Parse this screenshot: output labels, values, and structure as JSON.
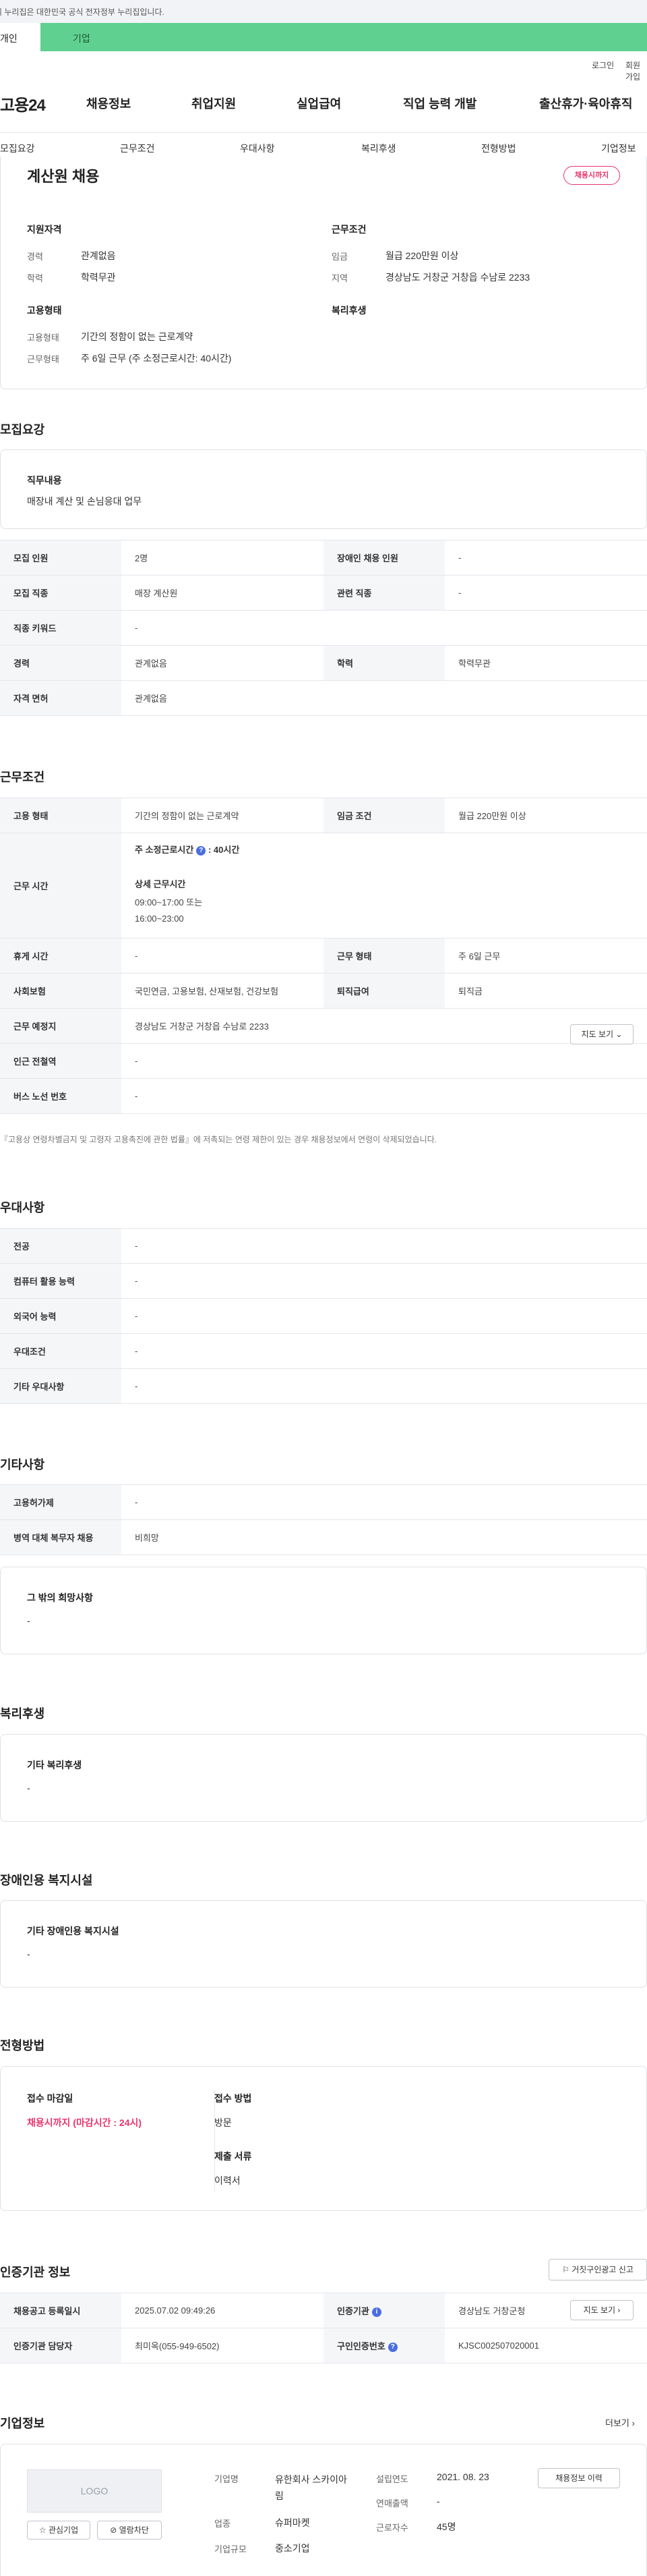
{
  "gov_notice": "이 누리집은 대한민국 공식 전자정부 누리집입니다.",
  "user_tabs": [
    "개인",
    "기업"
  ],
  "util_links": [
    "로그인",
    "회원가입"
  ],
  "logo": "고용24",
  "gnb": [
    "채용정보",
    "취업지원",
    "실업급여",
    "직업 능력 개발",
    "출산휴가·육아휴직"
  ],
  "subnav": [
    "모집요강",
    "근무조건",
    "우대사항",
    "복리후생",
    "전형방법",
    "기업정보"
  ],
  "job": {
    "title": "계산원 채용",
    "status_badge": "채용시까지",
    "qual_title": "지원자격",
    "career_label": "경력",
    "career_value": "관계없음",
    "edu_label": "학력",
    "edu_value": "학력무관",
    "cond_title": "근무조건",
    "wage_label": "임금",
    "wage_value": "월급 220만원 이상",
    "region_label": "지역",
    "region_value": "경상남도 거창군 거창읍 수남로 2233",
    "emp_title": "고용형태",
    "emp_type_label": "고용형태",
    "emp_type_value": "기간의 정함이 없는 근로계약",
    "work_form_label": "근무형태",
    "work_form_value": "주 6일 근무 (주 소정근로시간: 40시간)",
    "welfare_title": "복리후생"
  },
  "recruit": {
    "title": "모집요강",
    "duty_label": "직무내용",
    "duty_value": "매장내 계산 및 손님응대 업무",
    "rows": [
      {
        "k1": "모집 인원",
        "v1": "2명",
        "k2": "장애인 채용 인원",
        "v2": "-"
      },
      {
        "k1": "모집 직종",
        "v1": "매장 계산원",
        "k2": "관련 직종",
        "v2": "-"
      },
      {
        "k1": "직종 키워드",
        "v1": "-"
      },
      {
        "k1": "경력",
        "v1": "관계없음",
        "k2": "학력",
        "v2": "학력무관"
      },
      {
        "k1": "자격 면허",
        "v1": "관계없음"
      }
    ]
  },
  "work": {
    "title": "근무조건",
    "emp_type_k": "고용 형태",
    "emp_type_v": "기간의 정함이 없는 근로계약",
    "wage_k": "임금 조건",
    "wage_v": "월급 220만원 이상",
    "hours_k": "근무 시간",
    "hours_weekly": "주 소정근로시간",
    "hours_weekly_val": ": 40시간",
    "hours_detail_label": "상세 근무시간",
    "hours_detail_1": "09:00~17:00 또는",
    "hours_detail_2": "16:00~23:00",
    "rest_k": "휴게 시간",
    "rest_v": "-",
    "form_k": "근무 형태",
    "form_v": "주 6일 근무",
    "ins_k": "사회보험",
    "ins_v": "국민연금, 고용보험, 산재보험, 건강보험",
    "sev_k": "퇴직급여",
    "sev_v": "퇴직금",
    "place_k": "근무 예정지",
    "place_v": "경상남도 거창군 거창읍 수남로 2233",
    "map_btn": "지도 보기",
    "subway_k": "인근 전철역",
    "subway_v": "-",
    "bus_k": "버스 노선 번호",
    "bus_v": "-",
    "note": "『고용상 연령차별금지 및 고령자 고용촉진에 관한 법률』에 저촉되는 연령 제한이 있는 경우 채용정보에서 연령이 삭제되었습니다."
  },
  "pref": {
    "title": "우대사항",
    "rows": [
      {
        "k": "전공",
        "v": "-"
      },
      {
        "k": "컴퓨터 활용 능력",
        "v": "-"
      },
      {
        "k": "외국어 능력",
        "v": "-"
      },
      {
        "k": "우대조건",
        "v": "-"
      },
      {
        "k": "기타 우대사항",
        "v": "-"
      }
    ]
  },
  "etc": {
    "title": "기타사항",
    "rows": [
      {
        "k": "고용허가제",
        "v": "-"
      },
      {
        "k": "병역 대체 복무자 채용",
        "v": "비희망"
      }
    ],
    "other_label": "그 밖의 희망사항",
    "other_value": "-"
  },
  "welfare": {
    "title": "복리후생",
    "label": "기타 복리후생",
    "value": "-"
  },
  "disab": {
    "title": "장애인용 복지시설",
    "label": "기타 장애인용 복지시설",
    "value": "-"
  },
  "screen": {
    "title": "전형방법",
    "deadline_label": "접수 마감일",
    "deadline_value": "채용시까지 (마감시간 : 24시)",
    "method_label": "접수 방법",
    "method_value": "방문",
    "docs_label": "제출 서류",
    "docs_value": "이력서"
  },
  "auth": {
    "title": "인증기관 정보",
    "report_btn": "거짓구인광고 신고",
    "reg_k": "채용공고 등록일시",
    "reg_v": "2025.07.02 09:49:26",
    "org_k": "인증기관",
    "org_v": "경상남도 거창군청",
    "map_btn": "지도 보기",
    "staff_k": "인증기관 담당자",
    "staff_v": "최미옥(055-949-6502)",
    "cert_k": "구인인증번호",
    "cert_v": "KJSC002507020001"
  },
  "company": {
    "title": "기업정보",
    "more": "더보기",
    "logo_text": "LOGO",
    "fav_btn": "관심기업",
    "block_btn": "열람차단",
    "name_k": "기업명",
    "name_v": "유한회사 스카이아림",
    "ind_k": "업종",
    "ind_v": "슈퍼마켓",
    "size_k": "기업규모",
    "size_v": "중소기업",
    "found_k": "설립연도",
    "found_v": "2021. 08. 23",
    "sales_k": "연매출액",
    "sales_v": "-",
    "emp_k": "근로자수",
    "emp_v": "45명",
    "history_btn": "채용정보 이력"
  },
  "colors": {
    "accent": "#5fd08f",
    "pink": "#e8356b",
    "header_gray": "#f5f6f8"
  }
}
